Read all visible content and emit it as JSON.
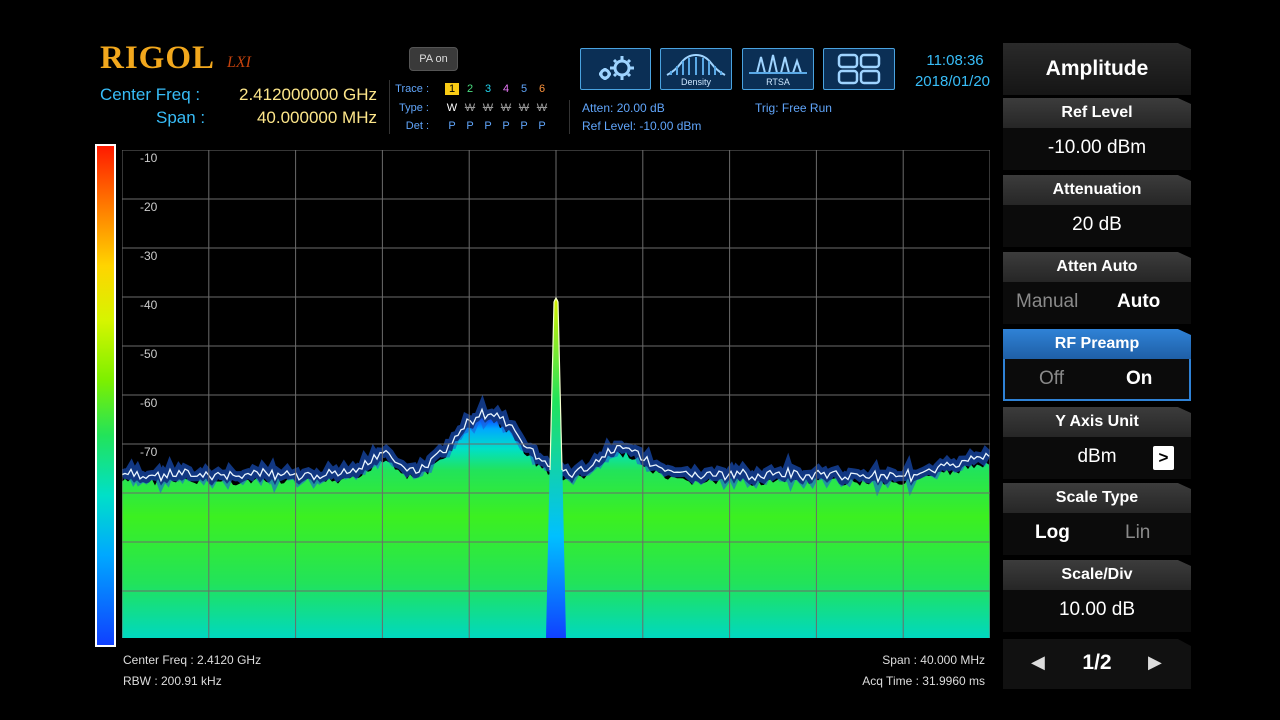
{
  "brand": {
    "logo": "RIGOL",
    "lxi": "LXI"
  },
  "header": {
    "center_freq_label": "Center Freq :",
    "center_freq_value": "2.412000000 GHz",
    "span_label": "Span :",
    "span_value": "40.000000 MHz",
    "pa_button": "PA on",
    "trace_label": "Trace :",
    "type_label": "Type :",
    "det_label": "Det :",
    "traces": [
      {
        "num": "1",
        "type": "W",
        "det": "P",
        "color": "#facc15"
      },
      {
        "num": "2",
        "type": "W",
        "det": "P",
        "color": "#4ade80"
      },
      {
        "num": "3",
        "type": "W",
        "det": "P",
        "color": "#22d3ee"
      },
      {
        "num": "4",
        "type": "W",
        "det": "P",
        "color": "#e879f9"
      },
      {
        "num": "5",
        "type": "W",
        "det": "P",
        "color": "#60a5fa"
      },
      {
        "num": "6",
        "type": "W",
        "det": "P",
        "color": "#fb923c"
      }
    ],
    "atten_status": "Atten: 20.00 dB",
    "ref_level_status": "Ref Level: -10.00 dBm",
    "trig_status": "Trig: Free Run",
    "time": "11:08:36",
    "date": "2018/01/20",
    "mode_buttons": [
      {
        "icon": "gear-icon",
        "caption": ""
      },
      {
        "icon": "density-icon",
        "caption": "Density"
      },
      {
        "icon": "rtsa-icon",
        "caption": "RTSA"
      },
      {
        "icon": "layout-grid-icon",
        "caption": ""
      }
    ]
  },
  "plot": {
    "y_ticks": [
      "-10",
      "-20",
      "-30",
      "-40",
      "-50",
      "-60",
      "-70"
    ]
  },
  "footer": {
    "center_freq": "Center Freq : 2.4120 GHz",
    "rbw": "RBW : 200.91 kHz",
    "span": "Span : 40.000 MHz",
    "acq_time": "Acq Time : 31.9960 ms"
  },
  "menu": {
    "title": "Amplitude",
    "ref_level": {
      "label": "Ref Level",
      "value": "-10.00 dBm"
    },
    "attenuation": {
      "label": "Attenuation",
      "value": "20 dB"
    },
    "atten_auto": {
      "label": "Atten Auto",
      "option_a": "Manual",
      "option_b": "Auto",
      "selected": "Auto"
    },
    "rf_preamp": {
      "label": "RF Preamp",
      "option_a": "Off",
      "option_b": "On",
      "selected": "On"
    },
    "y_axis_unit": {
      "label": "Y Axis Unit",
      "value": "dBm",
      "arrow": ">"
    },
    "scale_type": {
      "label": "Scale Type",
      "option_a": "Log",
      "option_b": "Lin",
      "selected": "Log"
    },
    "scale_div": {
      "label": "Scale/Div",
      "value": "10.00 dB"
    },
    "page": "1/2",
    "prev": "◀",
    "next": "▶"
  },
  "colors": {
    "accent": "#2f82d6",
    "label_blue": "#38bdf8",
    "logo_gold": "#f2a81d"
  }
}
